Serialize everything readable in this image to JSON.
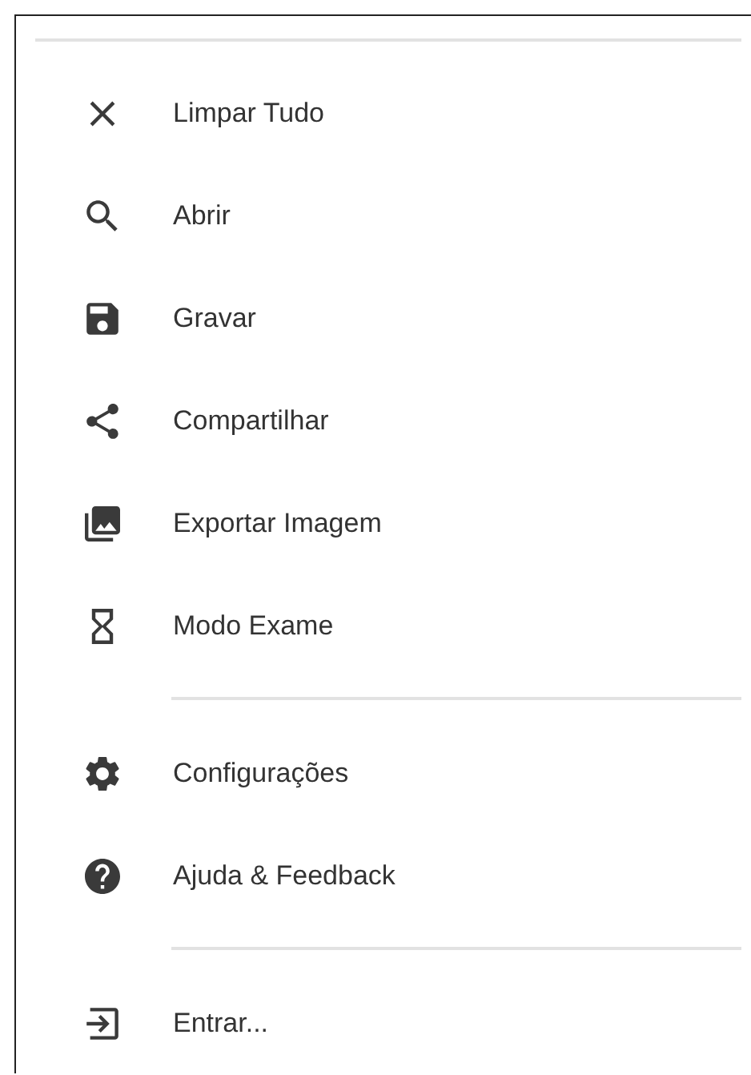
{
  "menu": {
    "sections": [
      {
        "items": [
          {
            "kind": "clear",
            "label": "Limpar Tudo"
          },
          {
            "kind": "open",
            "label": "Abrir"
          },
          {
            "kind": "save",
            "label": "Gravar"
          },
          {
            "kind": "share",
            "label": "Compartilhar"
          },
          {
            "kind": "export",
            "label": "Exportar Imagem"
          },
          {
            "kind": "exam",
            "label": "Modo Exame"
          }
        ]
      },
      {
        "items": [
          {
            "kind": "settings",
            "label": "Configurações"
          },
          {
            "kind": "help",
            "label": "Ajuda & Feedback"
          }
        ]
      },
      {
        "items": [
          {
            "kind": "login",
            "label": "Entrar..."
          }
        ]
      }
    ]
  }
}
